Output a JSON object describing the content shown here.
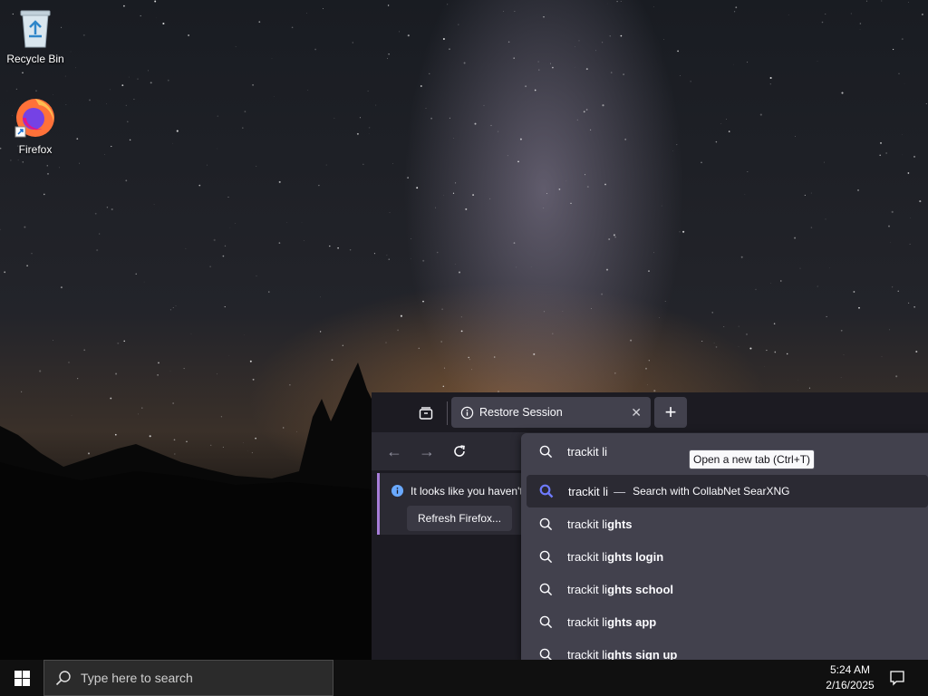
{
  "desktop": {
    "icons": [
      {
        "label": "Recycle Bin",
        "icon": "recycle-bin-icon"
      },
      {
        "label": "Firefox",
        "icon": "firefox-icon"
      }
    ]
  },
  "browser": {
    "tab": {
      "title": "Restore Session",
      "close": "✕",
      "icon": "info-icon"
    },
    "new_tab_label": "+",
    "new_tab_tooltip": "Open a new tab (Ctrl+T)",
    "nav": {
      "back": "←",
      "forward": "→",
      "reload": "⟳"
    },
    "infobar": {
      "message": "It looks like you haven't",
      "button": "Refresh Firefox..."
    },
    "urlbar": {
      "typed": "trackit li",
      "selected": {
        "typed": "trackit li",
        "dash": "—",
        "action": "Search with CollabNet SearXNG"
      },
      "suggestions": [
        {
          "prefix": "trackit li",
          "completion": "ghts"
        },
        {
          "prefix": "trackit li",
          "completion": "ghts login"
        },
        {
          "prefix": "trackit li",
          "completion": "ghts school"
        },
        {
          "prefix": "trackit li",
          "completion": "ghts app"
        },
        {
          "prefix": "trackit li",
          "completion": "ghts sign up"
        }
      ]
    }
  },
  "taskbar": {
    "search_placeholder": "Type here to search",
    "time": "5:24 AM",
    "date": "2/16/2025"
  },
  "colors": {
    "accent": "#a77dd9",
    "search_highlight": "#6e7bff"
  }
}
